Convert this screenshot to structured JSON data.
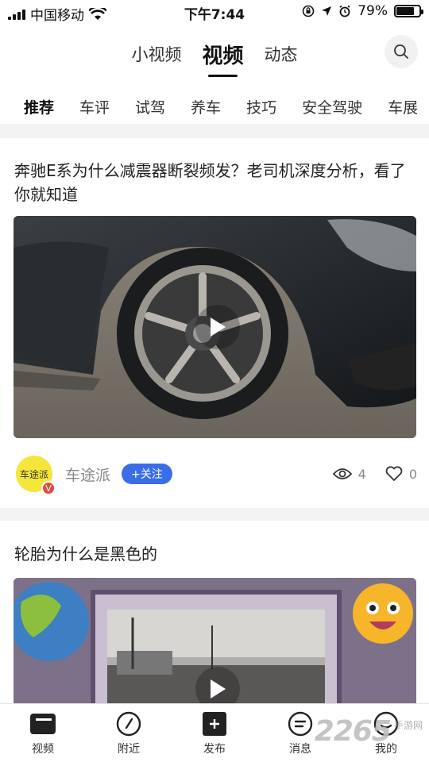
{
  "status_bar": {
    "carrier": "中国移动",
    "time": "下午7:44",
    "battery": "79%",
    "battery_level": 0.79,
    "icons": [
      "signal-icon",
      "wifi-icon",
      "rotation-lock-icon",
      "location-icon",
      "alarm-icon",
      "battery-icon"
    ]
  },
  "top_tabs": [
    {
      "label": "小视频",
      "active": false
    },
    {
      "label": "视频",
      "active": true
    },
    {
      "label": "动态",
      "active": false
    }
  ],
  "categories": [
    "推荐",
    "车评",
    "试驾",
    "养车",
    "技巧",
    "安全驾驶",
    "车展"
  ],
  "feed": [
    {
      "title": "奔驰E系为什么减震器断裂频发？老司机深度分析，看了你就知道",
      "author": "车途派",
      "avatar_text": "车途派",
      "badge": "V",
      "follow_label": "+关注",
      "views": "4",
      "likes": "0"
    },
    {
      "title": "轮胎为什么是黑色的"
    }
  ],
  "bottom_nav": [
    {
      "label": "视频",
      "icon": "video-icon"
    },
    {
      "label": "附近",
      "icon": "compass-icon"
    },
    {
      "label": "发布",
      "icon": "publish-icon"
    },
    {
      "label": "消息",
      "icon": "message-icon"
    },
    {
      "label": "我的",
      "icon": "profile-icon"
    }
  ],
  "watermark": {
    "number": "2265",
    "text": "手游网"
  },
  "colors": {
    "accent": "#3a6ee8",
    "badge": "#e8463f",
    "avatar_bg": "#f5e63c"
  }
}
